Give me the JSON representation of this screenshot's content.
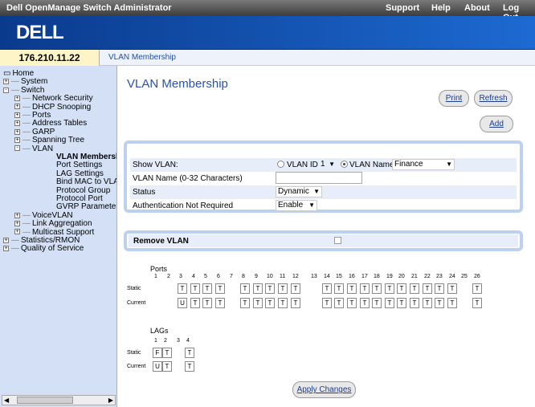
{
  "topbar": {
    "app_title": "Dell OpenManage Switch Administrator",
    "links": [
      "Support",
      "Help",
      "About",
      "Log Out"
    ]
  },
  "logo": "DELL",
  "device_ip": "176.210.11.22",
  "breadcrumb": "VLAN Membership",
  "sidebar": {
    "items": [
      {
        "label": "Home",
        "expander": ""
      },
      {
        "label": "System",
        "expander": "+"
      },
      {
        "label": "Switch",
        "expander": "-"
      },
      {
        "label": "Network Security",
        "expander": "+"
      },
      {
        "label": "DHCP Snooping",
        "expander": "+"
      },
      {
        "label": "Ports",
        "expander": "+"
      },
      {
        "label": "Address Tables",
        "expander": "+"
      },
      {
        "label": "GARP",
        "expander": "+"
      },
      {
        "label": "Spanning Tree",
        "expander": "+"
      },
      {
        "label": "VLAN",
        "expander": "-"
      },
      {
        "label": "VLAN Membersh",
        "expander": ""
      },
      {
        "label": "Port Settings",
        "expander": ""
      },
      {
        "label": "LAG Settings",
        "expander": ""
      },
      {
        "label": "Bind MAC to VLA",
        "expander": ""
      },
      {
        "label": "Protocol Group",
        "expander": ""
      },
      {
        "label": "Protocol Port",
        "expander": ""
      },
      {
        "label": "GVRP Parameter",
        "expander": ""
      },
      {
        "label": "VoiceVLAN",
        "expander": "+"
      },
      {
        "label": "Link Aggregation",
        "expander": "+"
      },
      {
        "label": "Multicast Support",
        "expander": "+"
      },
      {
        "label": "Statistics/RMON",
        "expander": "+"
      },
      {
        "label": "Quality of Service",
        "expander": "+"
      }
    ]
  },
  "page": {
    "title": "VLAN Membership"
  },
  "buttons": {
    "print": "Print",
    "refresh": "Refresh",
    "add": "Add",
    "apply": "Apply Changes"
  },
  "form": {
    "show_vlan": {
      "label": "Show VLAN:",
      "vlan_id_label": "VLAN ID",
      "vlan_id_value": "1",
      "vlan_name_label": "VLAN Name",
      "vlan_name_value": "Finance"
    },
    "vlan_name": {
      "label": "VLAN Name (0-32 Characters)",
      "value": ""
    },
    "status": {
      "label": "Status",
      "value": "Dynamic"
    },
    "auth": {
      "label": "Authentication Not Required",
      "value": "Enable"
    }
  },
  "remove_vlan": {
    "label": "Remove VLAN",
    "checked": false
  },
  "ports": {
    "title": "Ports",
    "static_label": "Static",
    "current_label": "Current",
    "numbers": [
      "1",
      "2",
      "3",
      "4",
      "5",
      "6",
      "7",
      "8",
      "9",
      "10",
      "11",
      "12",
      "13",
      "14",
      "15",
      "16",
      "17",
      "18",
      "19",
      "20",
      "21",
      "22",
      "23",
      "24",
      "25",
      "26"
    ],
    "static": [
      "",
      "",
      "T",
      "T",
      "T",
      "T",
      "",
      "T",
      "T",
      "T",
      "T",
      "T",
      "",
      "T",
      "T",
      "T",
      "T",
      "T",
      "T",
      "T",
      "T",
      "T",
      "T",
      "T",
      "",
      "T"
    ],
    "current": [
      "",
      "",
      "U",
      "T",
      "T",
      "T",
      "",
      "T",
      "T",
      "T",
      "T",
      "T",
      "",
      "T",
      "T",
      "T",
      "T",
      "T",
      "T",
      "T",
      "T",
      "T",
      "T",
      "T",
      "",
      "T"
    ]
  },
  "lags": {
    "title": "LAGs",
    "static_label": "Static",
    "current_label": "Current",
    "numbers": [
      "1",
      "2",
      "3",
      "4"
    ],
    "static": [
      "F",
      "T",
      "",
      "T"
    ],
    "current": [
      "U",
      "T",
      "",
      "T"
    ]
  }
}
